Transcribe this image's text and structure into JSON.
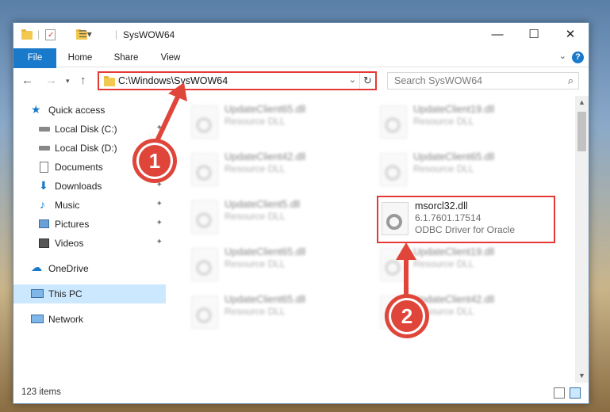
{
  "window": {
    "title": "SysWOW64"
  },
  "ribbon": {
    "tabs": [
      "File",
      "Home",
      "Share",
      "View"
    ]
  },
  "address": {
    "path": "C:\\Windows\\SysWOW64"
  },
  "search": {
    "placeholder": "Search SysWOW64"
  },
  "sidebar": {
    "items": [
      {
        "label": "Quick access"
      },
      {
        "label": "Local Disk (C:)"
      },
      {
        "label": "Local Disk (D:)"
      },
      {
        "label": "Documents"
      },
      {
        "label": "Downloads"
      },
      {
        "label": "Music"
      },
      {
        "label": "Pictures"
      },
      {
        "label": "Videos"
      },
      {
        "label": "OneDrive"
      },
      {
        "label": "This PC"
      },
      {
        "label": "Network"
      }
    ]
  },
  "files": {
    "col1": [
      {
        "name": "UpdateClient65.dll",
        "type": "Resource DLL"
      },
      {
        "name": "UpdateClient42.dll",
        "type": "Resource DLL"
      },
      {
        "name": "UpdateClient5.dll",
        "type": "Resource DLL"
      },
      {
        "name": "UpdateClient65.dll",
        "type": "Resource DLL"
      },
      {
        "name": "UpdateClient65.dll",
        "type": "Resource DLL"
      }
    ],
    "col2": [
      {
        "name": "UpdateClient19.dll",
        "type": "Resource DLL"
      },
      {
        "name": "UpdateClient65.dll",
        "type": "Resource DLL"
      },
      {
        "name": "UpdateClient19.dll",
        "type": "Resource DLL"
      },
      {
        "name": "UpdateClient42.dll",
        "type": "Resource DLL"
      }
    ],
    "target": {
      "name": "msorcl32.dll",
      "version": "6.1.7601.17514",
      "description": "ODBC Driver for Oracle"
    }
  },
  "status": {
    "item_count": "123 items"
  },
  "annotations": {
    "step1": "1",
    "step2": "2"
  },
  "colors": {
    "accent": "#1979ca",
    "highlight": "#e53935",
    "selected": "#cce8ff"
  }
}
